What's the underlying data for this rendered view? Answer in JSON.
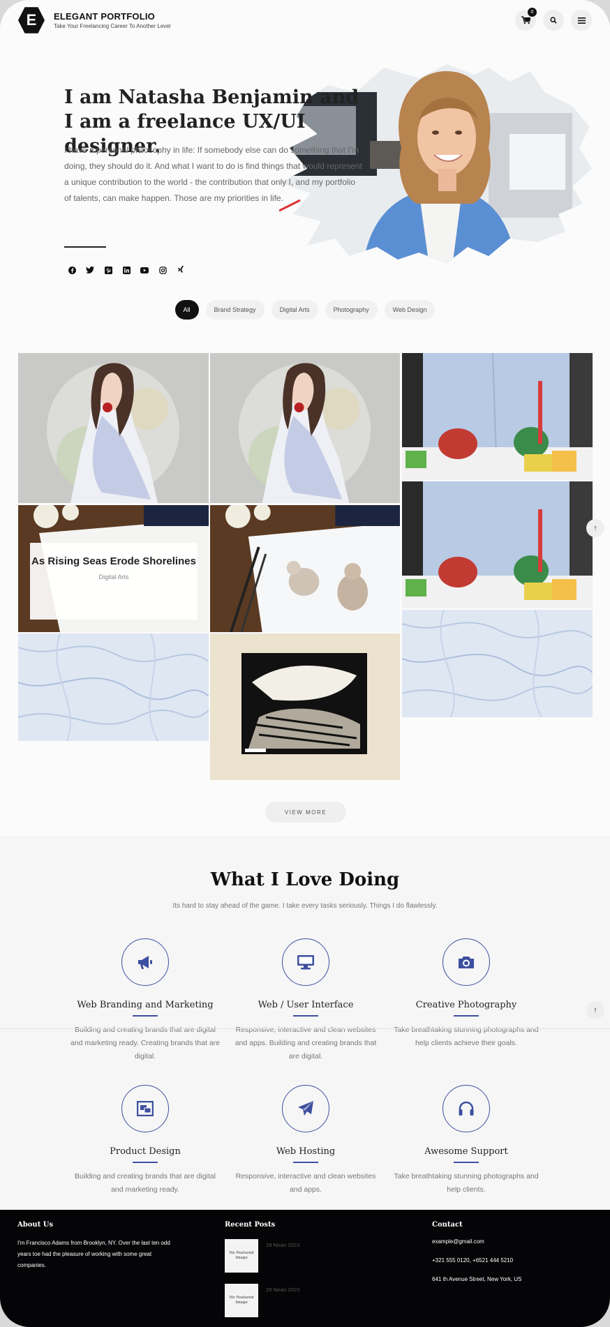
{
  "header": {
    "logo_letter": "E",
    "title": "ELEGANT PORTFOLIO",
    "subtitle": "Take Your Freelancing Career To Another Level",
    "cart_count": "0",
    "icons": [
      "cart-icon",
      "search-icon",
      "menu-icon"
    ]
  },
  "hero": {
    "title": "I am Natasha Benjamin and I am a freelance UX/UI designer.",
    "text": "I have a personal philosophy in life: If somebody else can do something that I'm doing, they should do it. And what I want to do is find things that would represent a unique contribution to the world - the contribution that only I, and my portfolio of talents, can make happen. Those are my priorities in life.",
    "socials": [
      "facebook-icon",
      "twitter-icon",
      "pinterest-icon",
      "linkedin-icon",
      "youtube-icon",
      "instagram-icon",
      "xing-icon"
    ]
  },
  "filters": [
    "All",
    "Brand Strategy",
    "Digital Arts",
    "Photography",
    "Web Design"
  ],
  "gallery": {
    "overlay_title": "As Rising Seas Erode Shorelines",
    "overlay_category": "Digital Arts",
    "view_more": "VIEW MORE"
  },
  "scroll_top_glyph": "↑",
  "services": {
    "title": "What I Love Doing",
    "subtitle": "Its hard to stay ahead of the game. I take every tasks seriously. Things I do flawlessly.",
    "items": [
      {
        "name": "Web Branding and Marketing",
        "desc": "Building and creating brands that are digital and marketing ready. Creating brands that are digital.",
        "icon": "megaphone-icon"
      },
      {
        "name": "Web / User Interface",
        "desc": "Responsive, interactive and clean websites and apps. Building and creating brands that are digital.",
        "icon": "monitor-icon"
      },
      {
        "name": "Creative Photography",
        "desc": "Take breathtaking stunning photographs and help clients achieve their goals.",
        "icon": "camera-icon"
      },
      {
        "name": "Product Design",
        "desc": "Building and creating brands that are digital and marketing ready.",
        "icon": "product-icon"
      },
      {
        "name": "Web Hosting",
        "desc": "Responsive, interactive and clean websites and apps.",
        "icon": "paper-plane-icon"
      },
      {
        "name": "Awesome Support",
        "desc": "Take breathtaking stunning photographs and help clients.",
        "icon": "headphones-icon"
      }
    ]
  },
  "footer": {
    "about_title": "About Us",
    "about_text": "I'm Francisco Adams from Brooklyn, NY. Over the last ten odd years toe had the pleasure of working with some great companies.",
    "posts_title": "Recent Posts",
    "posts": [
      {
        "thumb": "No Featured Image",
        "date": "29 Nisan 2023"
      },
      {
        "thumb": "No Featured Image",
        "date": "29 Nisan 2023"
      }
    ],
    "contact_title": "Contact",
    "email": "example@gmail.com",
    "phone": "+321 555 0120, +6521 444 5210",
    "address": "641 th Avenue Street, New York, US"
  },
  "colors": {
    "accent": "#3d4fa0",
    "dark": "#111111",
    "footer_bg": "#050507"
  }
}
